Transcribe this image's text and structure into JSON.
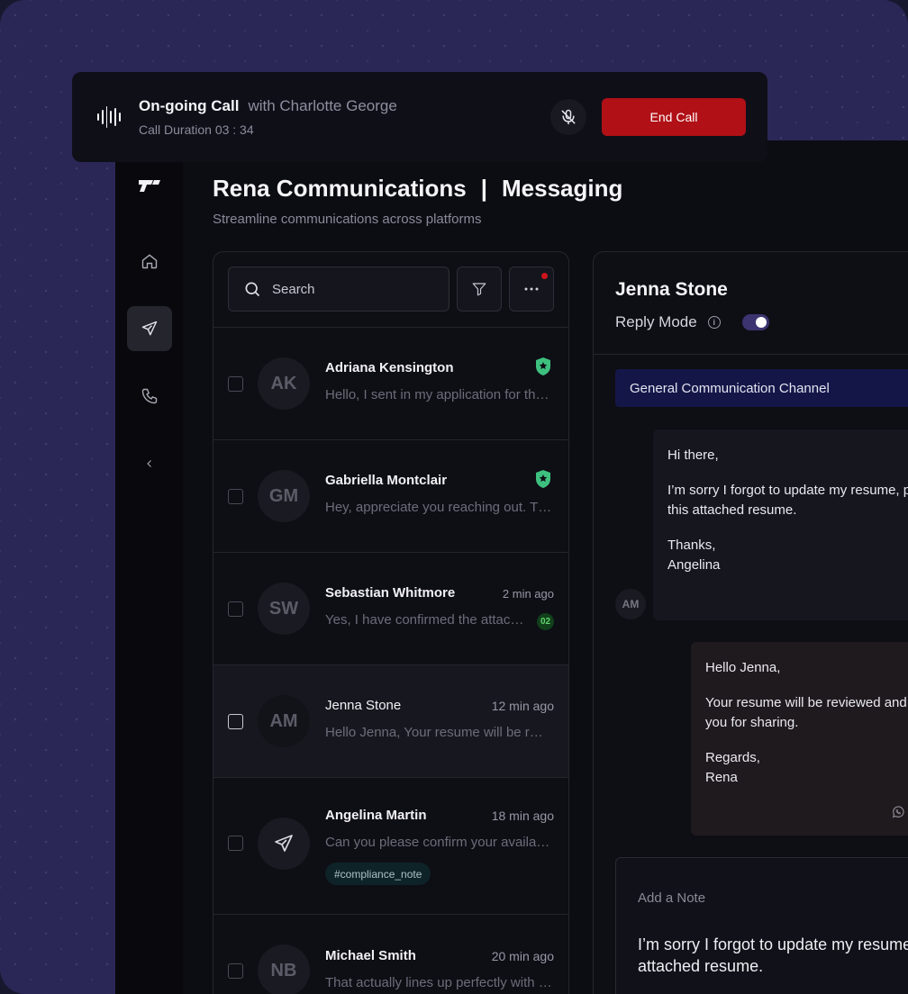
{
  "call": {
    "title": "On-going Call",
    "with": "with Charlotte George",
    "duration": "Call Duration 03 : 34",
    "end_label": "End Call"
  },
  "header": {
    "brand": "Rena Communications",
    "separator": "|",
    "section": "Messaging",
    "subtitle": "Streamline communications across platforms"
  },
  "search": {
    "placeholder": "Search"
  },
  "conversations": [
    {
      "initials": "AK",
      "name": "Adriana Kensington",
      "time": "",
      "preview": "Hello, I sent in my application for the position",
      "badge": "",
      "tag": ""
    },
    {
      "initials": "GM",
      "name": "Gabriella Montclair",
      "time": "",
      "preview": "Hey, appreciate you reaching out. Thanks",
      "badge": "",
      "tag": ""
    },
    {
      "initials": "SW",
      "name": "Sebastian Whitmore",
      "time": "2 min ago",
      "preview": "Yes, I have confirmed the attachment",
      "badge": "02",
      "tag": ""
    },
    {
      "initials": "AM",
      "name": "Jenna Stone",
      "time": "12 min ago",
      "preview": "Hello Jenna, Your resume will be reviewed",
      "badge": "",
      "tag": ""
    },
    {
      "initials": "",
      "name": "Angelina Martin",
      "time": "18 min ago",
      "preview": "Can you please confirm your availability",
      "badge": "",
      "tag": "#compliance_note"
    },
    {
      "initials": "NB",
      "name": "Michael Smith",
      "time": "20 min ago",
      "preview": "That actually lines up perfectly with my schedule",
      "badge": "",
      "tag": ""
    }
  ],
  "chat": {
    "name": "Jenna Stone",
    "reply_mode_label": "Reply Mode",
    "reply_mode_on": true,
    "channel": "General Communication Channel",
    "incoming": {
      "sender_initials": "AM",
      "greeting": "Hi there,",
      "body_line1": "I’m sorry I forgot to update my resume, please see",
      "body_line2": "this attached resume.",
      "closing": "Thanks,",
      "signature": "Angelina"
    },
    "outgoing": {
      "greeting": "Hello Jenna,",
      "body_line1": "Your resume will be reviewed and we will get back to",
      "body_line2": "you for sharing.",
      "closing": "Regards,",
      "signature": "Rena"
    },
    "note": {
      "label": "Add a Note",
      "text": "I’m sorry I forgot to update my resume, please see this\nattached resume."
    }
  },
  "colors": {
    "accent_end_call": "#b01016",
    "channel_bg": "#151648",
    "badge_green": "#61d36b"
  }
}
